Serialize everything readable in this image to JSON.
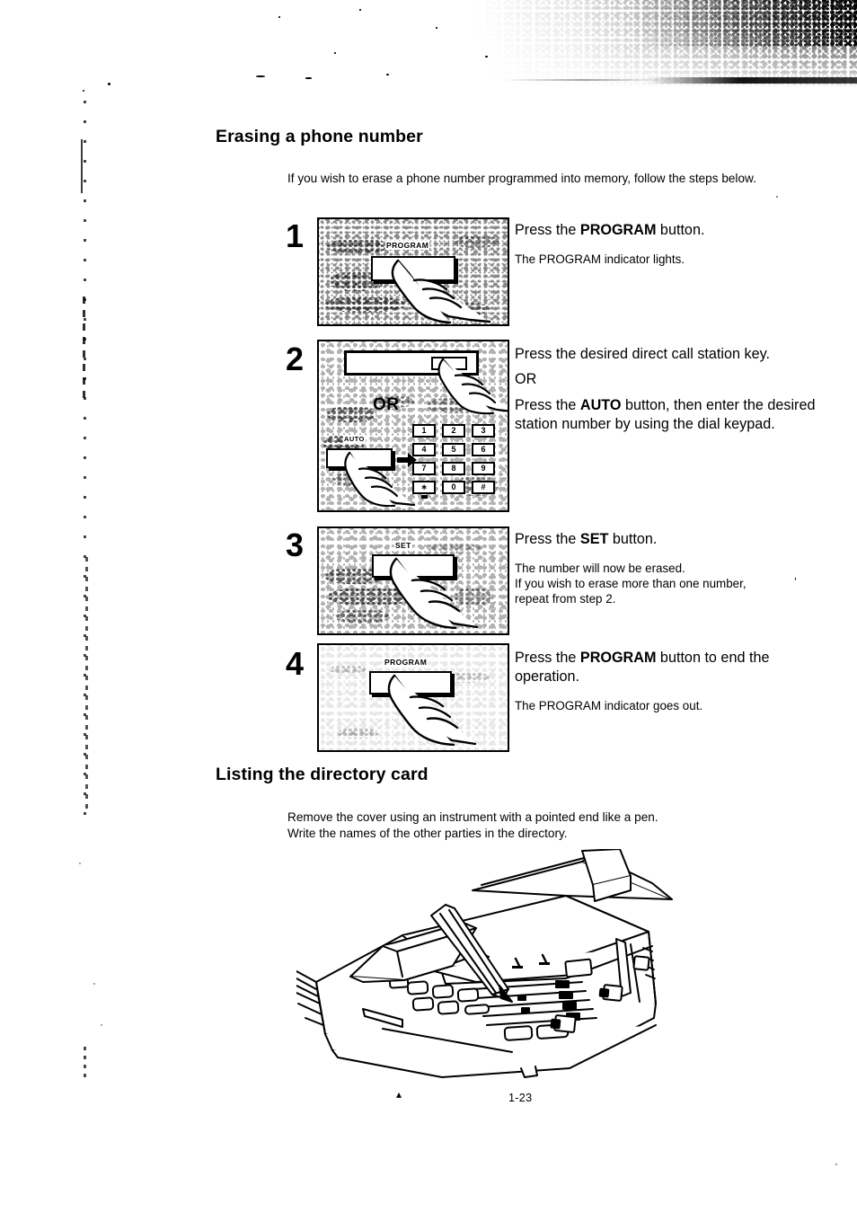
{
  "document": {
    "page_number": "1-23",
    "footer_mark": "▴"
  },
  "sections": [
    {
      "id": "erasing",
      "heading": "Erasing a phone number",
      "intro": "If you wish to erase a phone number programmed into memory, follow the steps below."
    },
    {
      "id": "listing",
      "heading": "Listing the directory card",
      "intro_line1": "Remove the cover using an instrument with a pointed end like a pen.",
      "intro_line2": "Write the names of the other parties in the directory."
    }
  ],
  "steps": [
    {
      "number": "1",
      "instruction_prefix": "Press the ",
      "instruction_bold": "PROGRAM",
      "instruction_suffix": " button.",
      "notes": [
        "The PROGRAM indicator lights."
      ],
      "figure": {
        "type": "photo-program-button",
        "button_label": "PROGRAM",
        "caption_alt": "A finger pressing the PROGRAM button on the fax control panel"
      }
    },
    {
      "number": "2",
      "instruction_prefix": "Press the desired direct call station key.",
      "instruction_bold": "",
      "instruction_suffix": "",
      "or_label": "OR",
      "instruction2_prefix": "Press the ",
      "instruction2_bold": "AUTO",
      "instruction2_suffix": " button, then enter the desired station number by using the dial keypad.",
      "notes": [],
      "figure": {
        "type": "photo-auto-and-keypad",
        "or_label": "OR",
        "button_label": "AUTO",
        "keypad_keys": [
          "1",
          "2",
          "3",
          "4",
          "5",
          "6",
          "7",
          "8",
          "9",
          "∗",
          "0",
          "#"
        ],
        "caption_alt": "A finger pressing a direct call station key, OR pressing AUTO then the dial keypad"
      }
    },
    {
      "number": "3",
      "instruction_prefix": "Press the ",
      "instruction_bold": "SET",
      "instruction_suffix": " button.",
      "notes": [
        "The number will now be erased.",
        "If you wish to erase more than one number,",
        "repeat from step 2."
      ],
      "stray_mark": "’",
      "figure": {
        "type": "photo-set-button",
        "button_label": "SET",
        "caption_alt": "A finger pressing the SET button"
      }
    },
    {
      "number": "4",
      "instruction_prefix": "Press the ",
      "instruction_bold": "PROGRAM",
      "instruction_suffix": " button to end the operation.",
      "notes": [
        "The PROGRAM indicator goes out."
      ],
      "figure": {
        "type": "photo-program-button",
        "button_label": "PROGRAM",
        "caption_alt": "A finger pressing the PROGRAM button to finish"
      }
    }
  ],
  "illustration": {
    "name": "fax-machine-directory-card",
    "caption_alt": "Line drawing of a fax machine with a pen lifting the directory card cover above the one-touch keys"
  },
  "colors": {
    "ink": "#000000",
    "paper": "#ffffff"
  }
}
